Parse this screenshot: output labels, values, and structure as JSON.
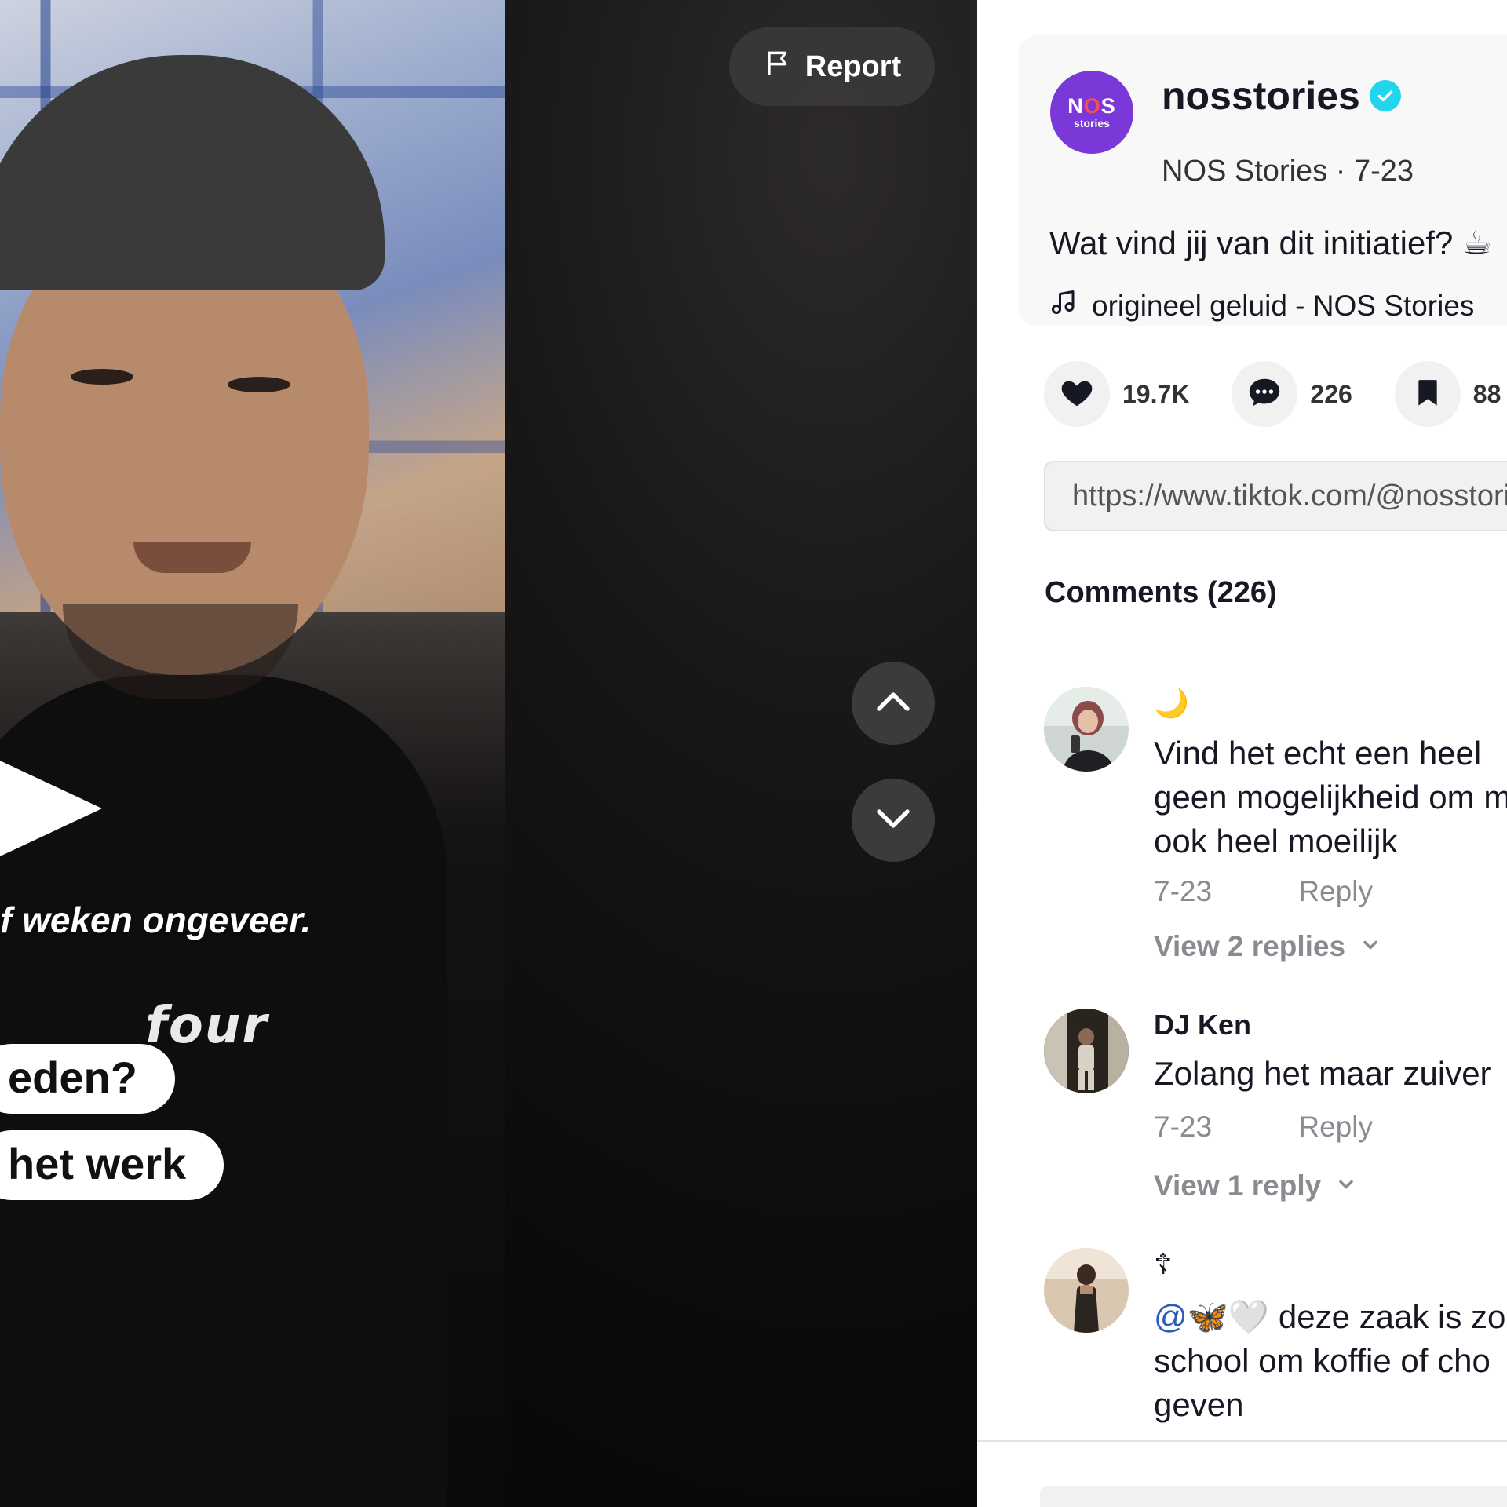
{
  "video": {
    "caption_line": "f weken ongeveer.",
    "pill_1": "eden?",
    "pill_2": "het werk",
    "brand_text": "four",
    "report_label": "Report"
  },
  "author": {
    "avatar_big": "NOS",
    "avatar_small": "stories",
    "username": "nosstories",
    "meta": "NOS Stories · 7-23",
    "caption": "Wat vind jij van dit initiatief? ☕",
    "music": "origineel geluid - NOS Stories"
  },
  "actions": {
    "likes": "19.7K",
    "comments": "226",
    "saves": "88"
  },
  "link": "https://www.tiktok.com/@nosstories",
  "comments_title": "Comments (226)",
  "comments": [
    {
      "name": "🌙",
      "line1": "Vind het echt een heel",
      "line2": "geen mogelijkheid om m",
      "line3": "ook heel moeilijk",
      "date": "7-23",
      "reply": "Reply",
      "replies": "View 2 replies"
    },
    {
      "name": "DJ Ken",
      "line1": "Zolang het maar zuiver",
      "date": "7-23",
      "reply": "Reply",
      "replies": "View 1 reply"
    },
    {
      "name": "☦",
      "mention": "@🦋🤍",
      "line1": " deze zaak is zo",
      "line2": "school om koffie of cho",
      "line3": "geven"
    }
  ],
  "colors": {
    "accent_purple": "#7b38d8",
    "verified": "#20d5ec",
    "mention": "#2b5db9"
  }
}
